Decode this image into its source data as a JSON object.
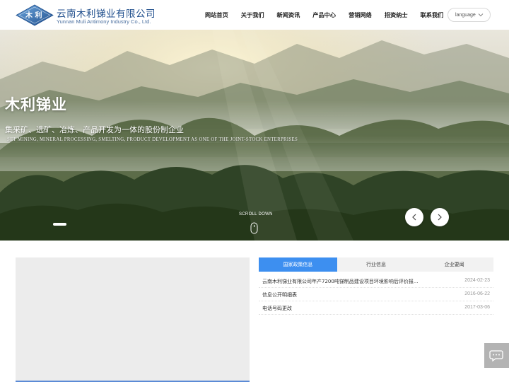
{
  "brand": {
    "badge_text": "木 利",
    "name_cn": "云南木利锑业有限公司",
    "name_en": "Yunnan Muli Antimony Industry Co., Ltd."
  },
  "nav": {
    "items": [
      "网站首页",
      "关于我们",
      "新闻资讯",
      "产品中心",
      "营销网络",
      "招资纳士",
      "联系我们"
    ],
    "language_label": "language"
  },
  "banner": {
    "title": "木利锑业",
    "subtitle_cn": "集采矿、选矿、冶炼、产品开发为一体的股份制企业",
    "subtitle_en": "SET MINING, MINERAL PROCESSING, SMELTING, PRODUCT DEVELOPMENT AS ONE OF THE JOINT-STOCK ENTERPRISES",
    "scroll_label": "SCROLL DOWN"
  },
  "news": {
    "tabs": [
      "国家政策信息",
      "行业信息",
      "企业要闻"
    ],
    "active_tab": 0,
    "items": [
      {
        "title": "云南木利锑业有限公司年产7200吨锑制品建设项目环境影响后评价报...",
        "date": "2024-02-23"
      },
      {
        "title": "信息公开明细表",
        "date": "2016-06-22"
      },
      {
        "title": "电话号码更改",
        "date": "2017-03-06"
      }
    ]
  },
  "icons": {
    "chevron": "chevron-down-icon",
    "prev": "chevron-left-icon",
    "next": "chevron-right-icon",
    "mouse": "mouse-icon",
    "chat": "chat-bubble-icon"
  },
  "colors": {
    "brand_blue": "#1f4e8c",
    "tab_active": "#3d8ff0"
  }
}
